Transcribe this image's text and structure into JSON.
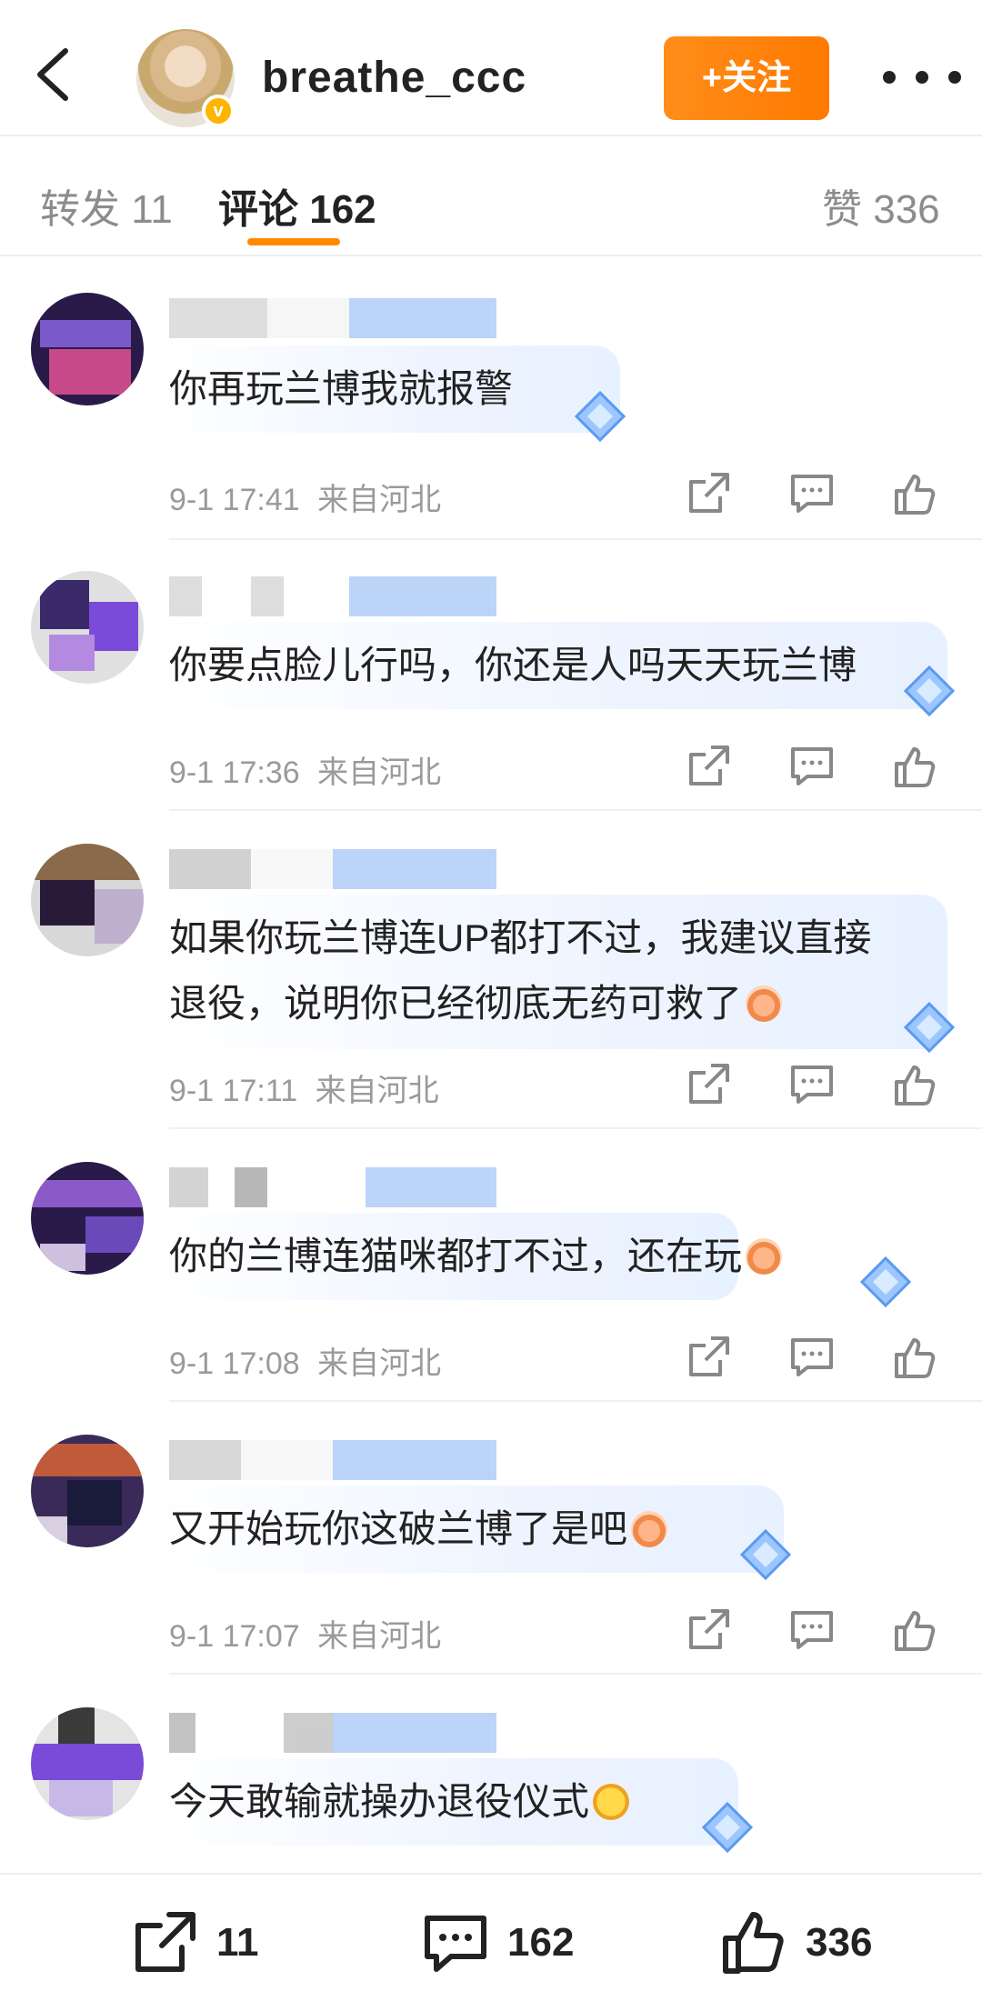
{
  "header": {
    "username": "breathe_ccc",
    "follow_label": "+关注",
    "verified_badge": "v",
    "icons": [
      "back-arrow-icon",
      "more-dots-icon"
    ]
  },
  "tabs": [
    {
      "label": "转发 11",
      "active": false
    },
    {
      "label": "评论 162",
      "active": true
    },
    {
      "label": "赞 336",
      "active": false
    }
  ],
  "comments": [
    {
      "text": "你再玩兰博我就报警",
      "time": "9-1 17:41",
      "location": "来自河北"
    },
    {
      "text": "你要点脸儿行吗，你还是人吗天天玩兰博",
      "time": "9-1 17:36",
      "location": "来自河北"
    },
    {
      "text_line1": "如果你玩兰博连UP都打不过，我建议直接",
      "text_line2": "退役，说明你已经彻底无药可救了",
      "time": "9-1 17:11",
      "location": "来自河北"
    },
    {
      "text": "你的兰博连猫咪都打不过，还在玩",
      "time": "9-1 17:08",
      "location": "来自河北"
    },
    {
      "text": "又开始玩你这破兰博了是吧",
      "time": "9-1 17:07",
      "location": "来自河北"
    },
    {
      "text": "今天敢输就操办退役仪式"
    }
  ],
  "bottom_bar": {
    "repost_count": "11",
    "comment_count": "162",
    "like_count": "336"
  },
  "colors": {
    "accent": "#ff8a00",
    "follow_button": "#ff7a00",
    "meta_text": "#9a9a9a"
  }
}
